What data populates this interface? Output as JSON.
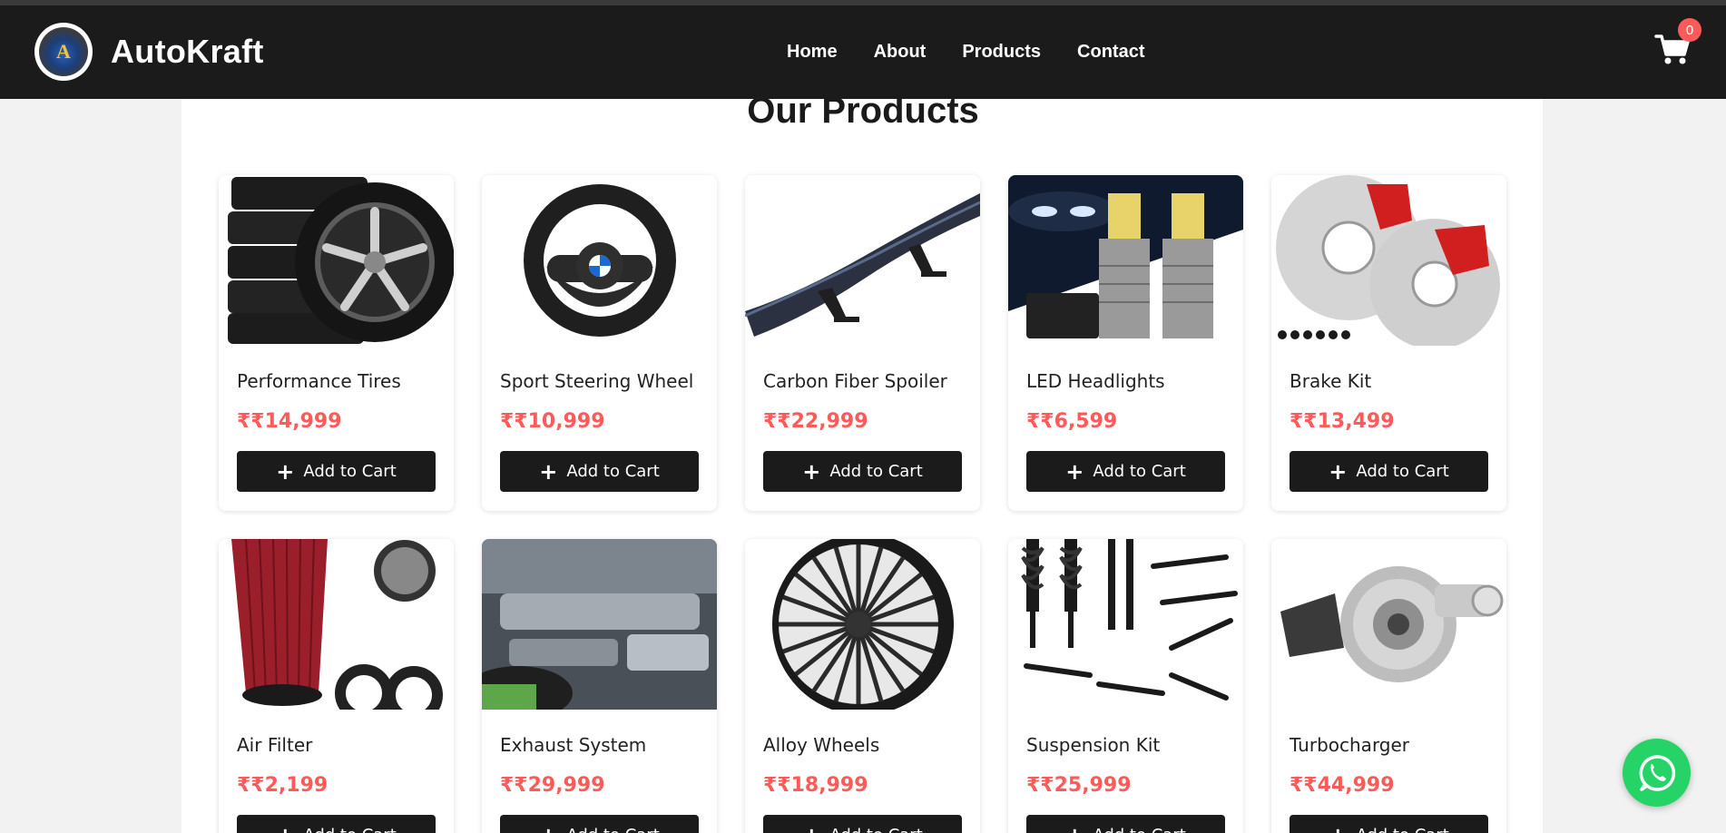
{
  "brand": {
    "name": "AutoKraft",
    "logo_letter": "A"
  },
  "nav": {
    "items": [
      "Home",
      "About",
      "Products",
      "Contact"
    ]
  },
  "cart": {
    "count": "0"
  },
  "page": {
    "title": "Our Products"
  },
  "add_to_cart_label": "Add to Cart",
  "products": [
    {
      "name": "Performance Tires",
      "price": "₹₹14,999",
      "image": "tires-image"
    },
    {
      "name": "Sport Steering Wheel",
      "price": "₹₹10,999",
      "image": "steering-wheel-image"
    },
    {
      "name": "Carbon Fiber Spoiler",
      "price": "₹₹22,999",
      "image": "spoiler-image"
    },
    {
      "name": "LED Headlights",
      "price": "₹₹6,599",
      "image": "headlights-image"
    },
    {
      "name": "Brake Kit",
      "price": "₹₹13,499",
      "image": "brake-kit-image"
    },
    {
      "name": "Air Filter",
      "price": "₹₹2,199",
      "image": "air-filter-image"
    },
    {
      "name": "Exhaust System",
      "price": "₹₹29,999",
      "image": "exhaust-image"
    },
    {
      "name": "Alloy Wheels",
      "price": "₹₹18,999",
      "image": "alloy-wheel-image"
    },
    {
      "name": "Suspension Kit",
      "price": "₹₹25,999",
      "image": "suspension-image"
    },
    {
      "name": "Turbocharger",
      "price": "₹₹44,999",
      "image": "turbocharger-image"
    }
  ],
  "colors": {
    "navbar": "#1b1b1b",
    "price": "#ff5a5a",
    "button": "#1b1b1b",
    "whatsapp": "#25d366",
    "badge": "#ff5a5a"
  },
  "icons": {
    "cart": "cart-icon",
    "whatsapp": "whatsapp-icon",
    "plus": "plus-icon"
  }
}
